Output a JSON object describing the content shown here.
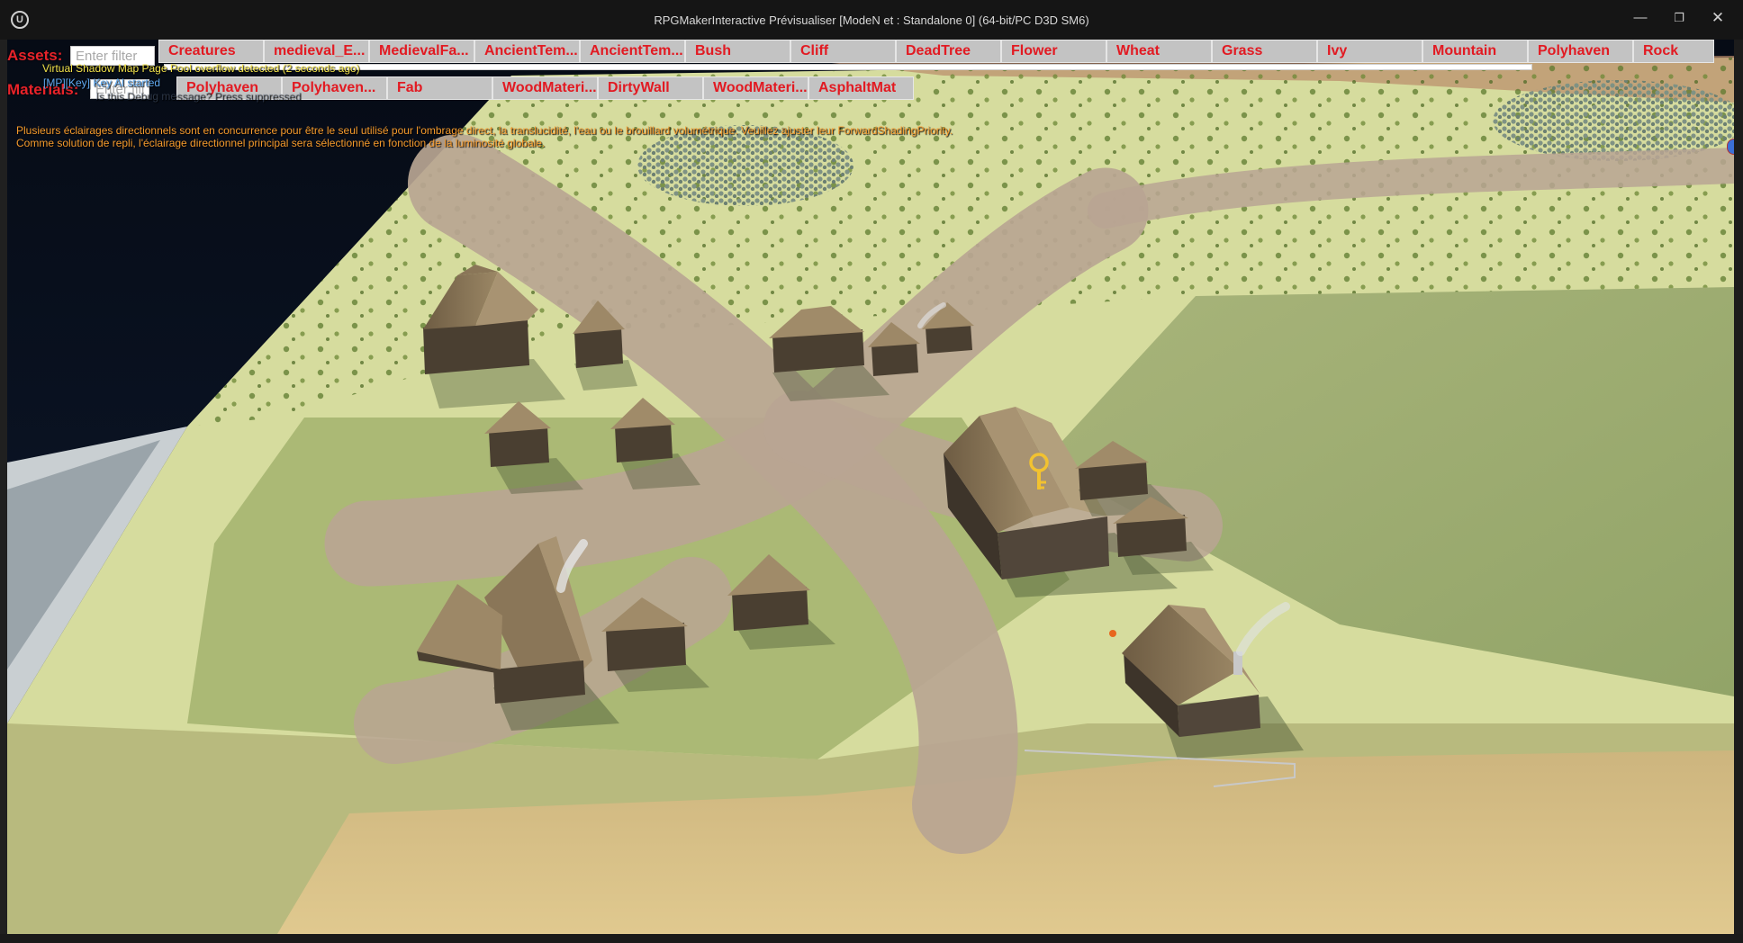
{
  "window": {
    "logo_glyph": "U",
    "title": "RPGMakerInteractive Prévisualiser [ModeN et : Standalone 0]  (64-bit/PC D3D SM6)",
    "minimize_glyph": "—",
    "maximize_glyph": "❐",
    "close_glyph": "✕"
  },
  "overlay": {
    "assets_label": "Assets:",
    "materials_label": "Materials:",
    "asset_filter_placeholder": "Enter filter",
    "material_filter_placeholder": "Enter filter",
    "asset_buttons": [
      "Creatures",
      "medieval_E...",
      "MedievalFa...",
      "AncientTem...",
      "AncientTem...",
      "Bush",
      "Cliff",
      "DeadTree",
      "Flower",
      "Wheat",
      "Grass",
      "Ivy",
      "Mountain",
      "Polyhaven",
      "Rock"
    ],
    "material_buttons": [
      "Polyhaven",
      "Polyhaven...",
      "Fab",
      "WoodMateri...",
      "DirtyWall",
      "WoodMateri...",
      "AsphaltMat"
    ]
  },
  "log": {
    "vsm": "Virtual Shadow Map Page Pool overflow detected (2 seconds ago)",
    "key": "[MP][Key] Key AI started",
    "faded": "Is this Debug message? Press suppressed",
    "warn_1": "Plusieurs éclairages directionnels sont en concurrence pour être le seul utilisé pour l'ombrage direct, la translucidité, l'eau ou le brouillard volumétrique. Veuillez ajuster leur ForwardShadingPriority.",
    "warn_2": "Comme solution de repli, l'éclairage directionnel principal sera sélectionné en fonction de la luminosité globale."
  },
  "colors": {
    "overlay_red": "#e21a22",
    "log_yellow": "#f2e24a",
    "log_blue": "#5fa8ee",
    "log_orange": "#f59a2c",
    "terrain_light": "#d9dea0",
    "terrain_green": "#8fa566",
    "road": "#b8a592",
    "sand": "#d8c28a",
    "roof": "#8a7658",
    "wall": "#4d4234"
  },
  "icons": {
    "key_marker": "golden-key-icon",
    "logo": "unreal-logo-icon"
  }
}
